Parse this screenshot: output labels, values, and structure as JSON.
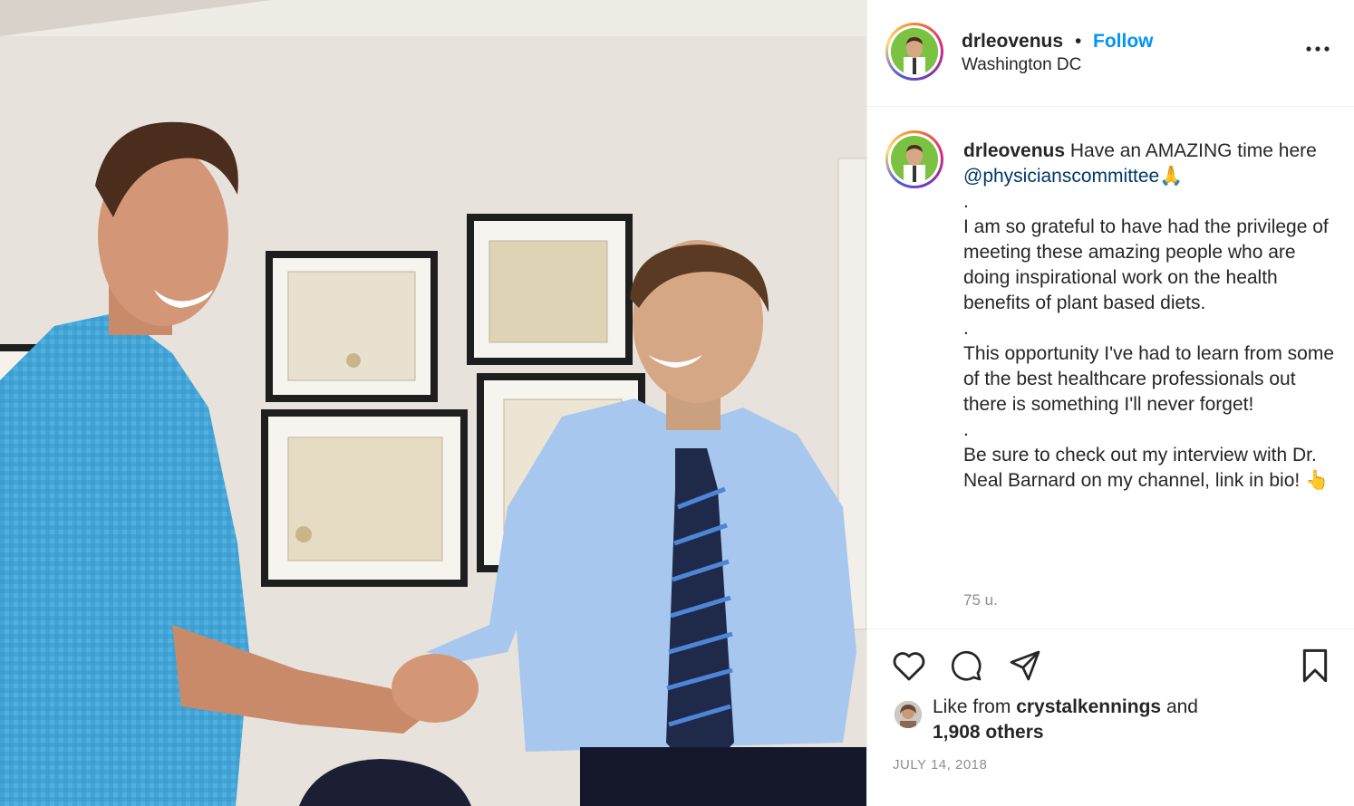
{
  "post": {
    "username": "drleovenus",
    "separator": "•",
    "follow_label": "Follow",
    "location": "Washington DC",
    "more_icon": "more-horizontal-icon"
  },
  "caption": {
    "username": "drleovenus",
    "line1": " Have an AMAZING time here ",
    "mention": "@physicianscommittee",
    "emoji1": "🙏",
    "dot": ".",
    "para1": "I am so grateful to have had the privilege of meeting these amazing people who are doing inspirational work on the health benefits of plant based diets.",
    "para2": "This opportunity I've had to learn from some of the best healthcare professionals out there is something I'll never forget!",
    "para3": "Be sure to check out my interview with Dr. Neal Barnard on my channel, link in bio! ",
    "emoji2": "👆",
    "age": "75 u."
  },
  "actions": {
    "like_icon": "heart-icon",
    "comment_icon": "comment-icon",
    "share_icon": "share-icon",
    "save_icon": "bookmark-icon",
    "like_prefix": "Like from ",
    "liker": "crystalkennings",
    "like_mid": " and",
    "others": "1,908 others",
    "date": "JULY 14, 2018"
  }
}
